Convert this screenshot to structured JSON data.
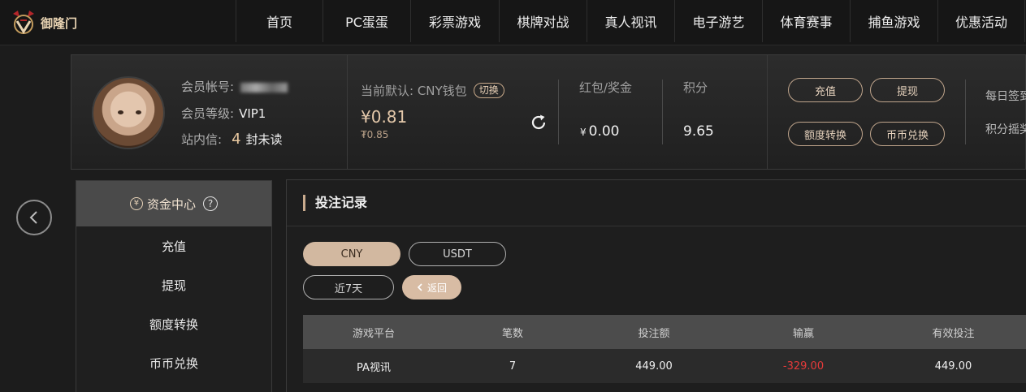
{
  "logo": {
    "name": "御隆门"
  },
  "nav": {
    "items": [
      "首页",
      "PC蛋蛋",
      "彩票游戏",
      "棋牌对战",
      "真人视讯",
      "电子游艺",
      "体育赛事",
      "捕鱼游戏",
      "优惠活动"
    ]
  },
  "profile": {
    "account_label": "会员帐号:",
    "level_label": "会员等级:",
    "level_value": "VIP1",
    "inbox_label": "站内信:",
    "inbox_count": "4",
    "inbox_unit": "封未读"
  },
  "wallet": {
    "label": "当前默认: CNY钱包",
    "switch_label": "切换",
    "balance": "¥0.81",
    "balance_sub": "₮0.85"
  },
  "stats": {
    "bonus_label": "红包/奖金",
    "bonus_currency": "¥",
    "bonus_value": "0.00",
    "points_label": "积分",
    "points_value": "9.65"
  },
  "actions": {
    "deposit": "充值",
    "withdraw": "提现",
    "transfer": "额度转换",
    "coin_exchange": "币币兑换"
  },
  "side": {
    "daily_signin": "每日签到",
    "points_lottery": "积分摇奖"
  },
  "menu": {
    "header": "资金中心",
    "items": [
      "充值",
      "提现",
      "额度转换",
      "币币兑换"
    ]
  },
  "panel": {
    "title": "投注记录",
    "currency_tabs": [
      "CNY",
      "USDT"
    ],
    "period": "近7天",
    "back": "返回"
  },
  "table": {
    "headers": [
      "游戏平台",
      "笔数",
      "投注额",
      "输赢",
      "有效投注"
    ],
    "rows": [
      [
        "PA视讯",
        "7",
        "449.00",
        "-329.00",
        "449.00"
      ]
    ]
  },
  "colors": {
    "accent": "#d2b8a0",
    "negative": "#e63a3a"
  }
}
